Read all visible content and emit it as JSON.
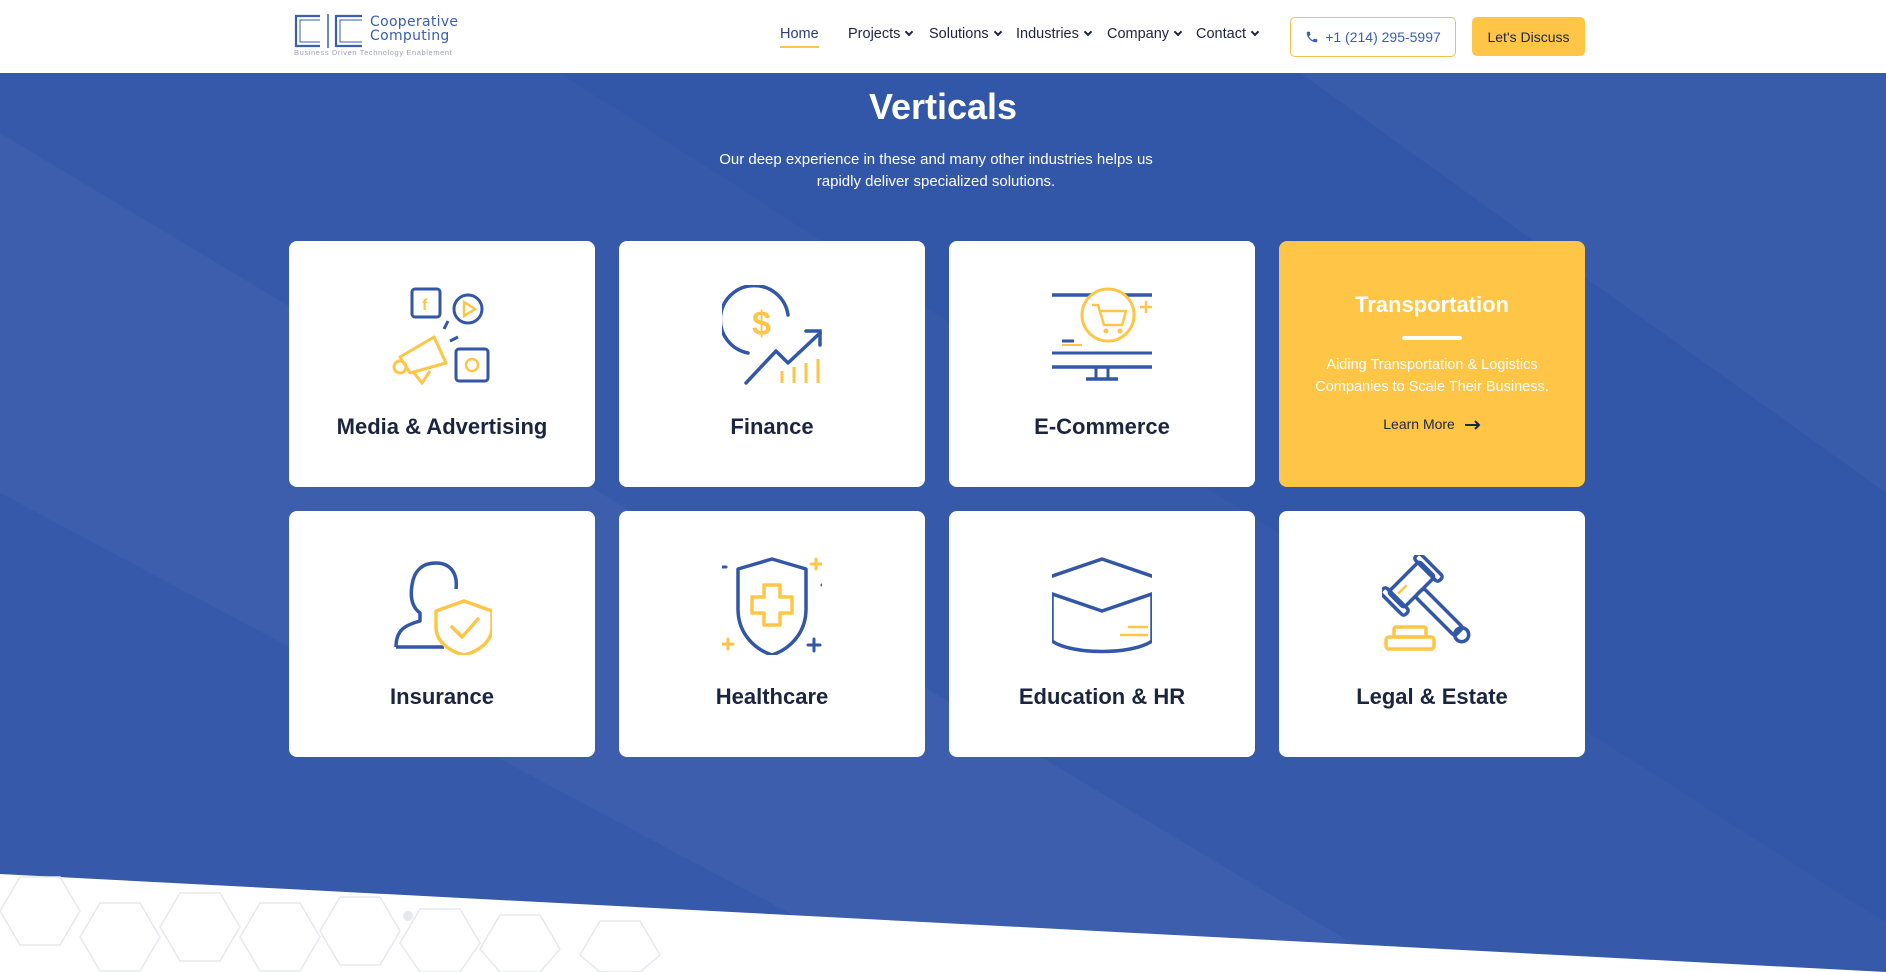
{
  "header": {
    "logo": {
      "line1": "Cooperative",
      "line2": "Computing",
      "tagline": "Business Driven Technology Enablement",
      "mark": "CC"
    },
    "nav": [
      {
        "label": "Home",
        "dropdown": false
      },
      {
        "label": "Projects",
        "dropdown": true
      },
      {
        "label": "Solutions",
        "dropdown": true
      },
      {
        "label": "Industries",
        "dropdown": true
      },
      {
        "label": "Company",
        "dropdown": true
      },
      {
        "label": "Contact",
        "dropdown": true
      }
    ],
    "phone": "+1 (214) 295-5997",
    "cta": "Let's Discuss"
  },
  "section": {
    "title": "Verticals",
    "subtitle": "Our deep experience in these and many other industries helps us rapidly deliver specialized solutions."
  },
  "cards": [
    {
      "label": "Media & Advertising",
      "icon": "megaphone-social-icon"
    },
    {
      "label": "Finance",
      "icon": "dollar-growth-icon"
    },
    {
      "label": "E-Commerce",
      "icon": "monitor-cart-icon"
    },
    {
      "label": "Transportation",
      "icon": "",
      "description": "Aiding Transportation & Logistics Companies to Scale Their Business.",
      "link": "Learn More"
    },
    {
      "label": "Insurance",
      "icon": "person-shield-icon"
    },
    {
      "label": "Healthcare",
      "icon": "medical-shield-icon"
    },
    {
      "label": "Education & HR",
      "icon": "graduation-cap-icon"
    },
    {
      "label": "Legal & Estate",
      "icon": "gavel-icon"
    }
  ],
  "colors": {
    "primary": "#3256a8",
    "accent": "#ffc547",
    "navy": "#1c2540",
    "white": "#ffffff"
  }
}
